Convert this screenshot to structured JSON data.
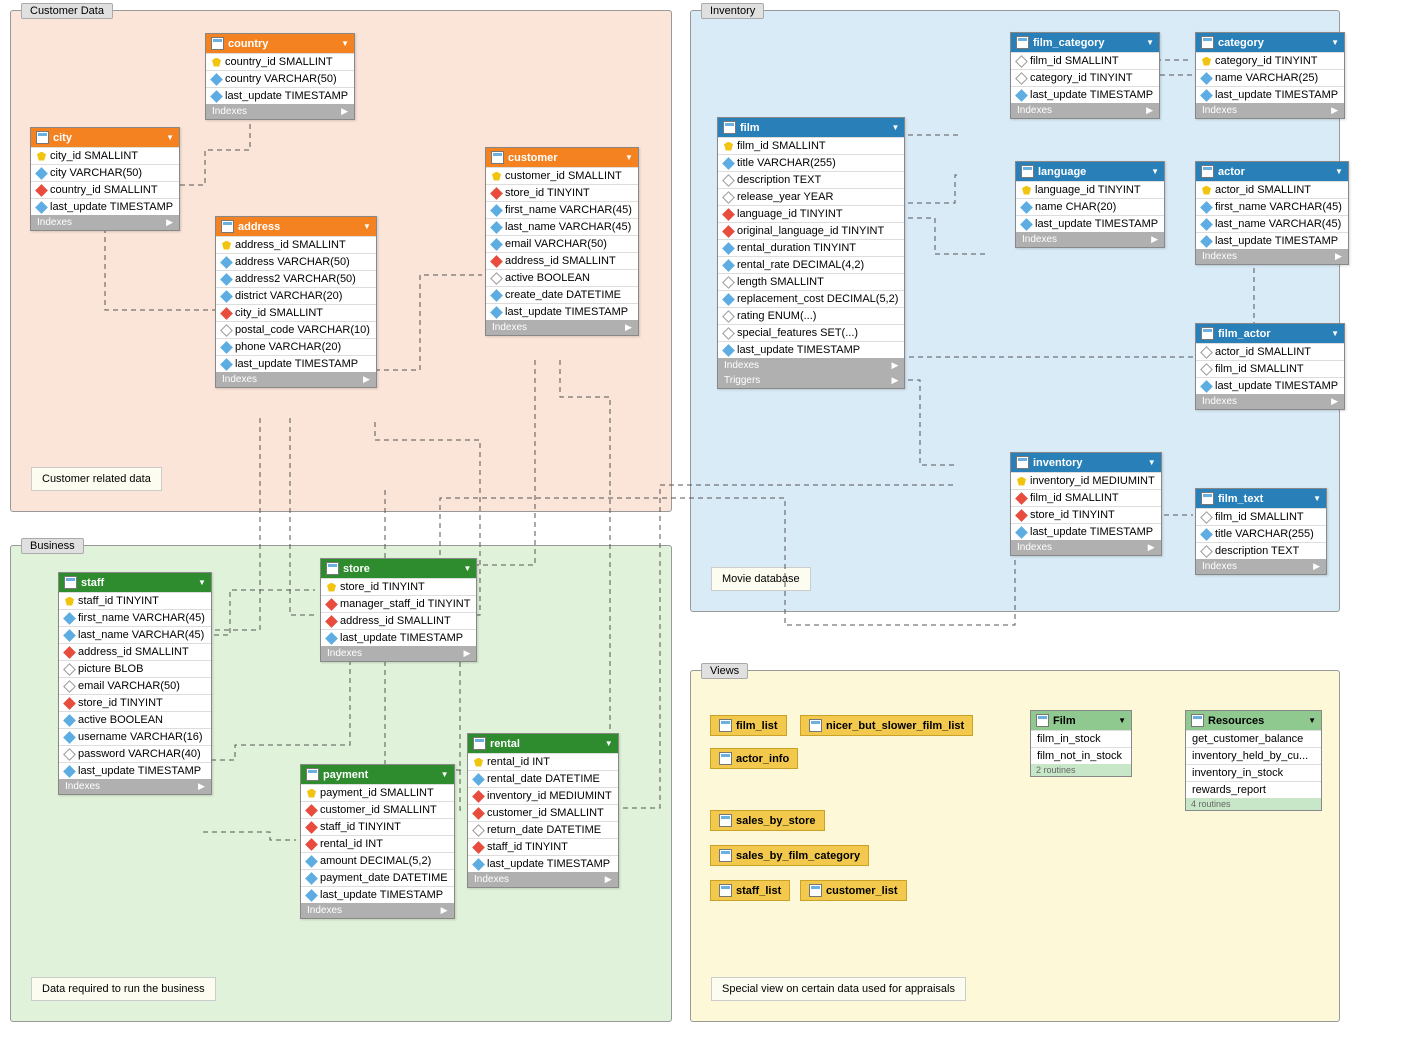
{
  "regions": {
    "customer": {
      "label": "Customer Data",
      "note": "Customer related data"
    },
    "business": {
      "label": "Business",
      "note": "Data required to run the business"
    },
    "inventory": {
      "label": "Inventory",
      "note": "Movie database"
    },
    "views": {
      "label": "Views",
      "note": "Special view on certain data used for appraisals"
    }
  },
  "tables": {
    "city": {
      "name": "city",
      "cols": [
        {
          "n": "city_id SMALLINT",
          "t": "key"
        },
        {
          "n": "city VARCHAR(50)",
          "t": "idx"
        },
        {
          "n": "country_id SMALLINT",
          "t": "fk"
        },
        {
          "n": "last_update TIMESTAMP",
          "t": "idx"
        }
      ]
    },
    "country": {
      "name": "country",
      "cols": [
        {
          "n": "country_id SMALLINT",
          "t": "key"
        },
        {
          "n": "country VARCHAR(50)",
          "t": "idx"
        },
        {
          "n": "last_update TIMESTAMP",
          "t": "idx"
        }
      ]
    },
    "address": {
      "name": "address",
      "cols": [
        {
          "n": "address_id SMALLINT",
          "t": "key"
        },
        {
          "n": "address VARCHAR(50)",
          "t": "idx"
        },
        {
          "n": "address2 VARCHAR(50)",
          "t": "idx"
        },
        {
          "n": "district VARCHAR(20)",
          "t": "idx"
        },
        {
          "n": "city_id SMALLINT",
          "t": "fk"
        },
        {
          "n": "postal_code VARCHAR(10)",
          "t": "col"
        },
        {
          "n": "phone VARCHAR(20)",
          "t": "idx"
        },
        {
          "n": "last_update TIMESTAMP",
          "t": "idx"
        }
      ]
    },
    "customer": {
      "name": "customer",
      "cols": [
        {
          "n": "customer_id SMALLINT",
          "t": "key"
        },
        {
          "n": "store_id TINYINT",
          "t": "fk"
        },
        {
          "n": "first_name VARCHAR(45)",
          "t": "idx"
        },
        {
          "n": "last_name VARCHAR(45)",
          "t": "idx"
        },
        {
          "n": "email VARCHAR(50)",
          "t": "idx"
        },
        {
          "n": "address_id SMALLINT",
          "t": "fk"
        },
        {
          "n": "active BOOLEAN",
          "t": "col"
        },
        {
          "n": "create_date DATETIME",
          "t": "idx"
        },
        {
          "n": "last_update TIMESTAMP",
          "t": "idx"
        }
      ]
    },
    "staff": {
      "name": "staff",
      "cols": [
        {
          "n": "staff_id TINYINT",
          "t": "key"
        },
        {
          "n": "first_name VARCHAR(45)",
          "t": "idx"
        },
        {
          "n": "last_name VARCHAR(45)",
          "t": "idx"
        },
        {
          "n": "address_id SMALLINT",
          "t": "fk"
        },
        {
          "n": "picture BLOB",
          "t": "col"
        },
        {
          "n": "email VARCHAR(50)",
          "t": "col"
        },
        {
          "n": "store_id TINYINT",
          "t": "fk"
        },
        {
          "n": "active BOOLEAN",
          "t": "idx"
        },
        {
          "n": "username VARCHAR(16)",
          "t": "idx"
        },
        {
          "n": "password VARCHAR(40)",
          "t": "col"
        },
        {
          "n": "last_update TIMESTAMP",
          "t": "idx"
        }
      ]
    },
    "store": {
      "name": "store",
      "cols": [
        {
          "n": "store_id TINYINT",
          "t": "key"
        },
        {
          "n": "manager_staff_id TINYINT",
          "t": "fk"
        },
        {
          "n": "address_id SMALLINT",
          "t": "fk"
        },
        {
          "n": "last_update TIMESTAMP",
          "t": "idx"
        }
      ]
    },
    "payment": {
      "name": "payment",
      "cols": [
        {
          "n": "payment_id SMALLINT",
          "t": "key"
        },
        {
          "n": "customer_id SMALLINT",
          "t": "fk"
        },
        {
          "n": "staff_id TINYINT",
          "t": "fk"
        },
        {
          "n": "rental_id INT",
          "t": "fk"
        },
        {
          "n": "amount DECIMAL(5,2)",
          "t": "idx"
        },
        {
          "n": "payment_date DATETIME",
          "t": "idx"
        },
        {
          "n": "last_update TIMESTAMP",
          "t": "idx"
        }
      ]
    },
    "rental": {
      "name": "rental",
      "cols": [
        {
          "n": "rental_id INT",
          "t": "key"
        },
        {
          "n": "rental_date DATETIME",
          "t": "idx"
        },
        {
          "n": "inventory_id MEDIUMINT",
          "t": "fk"
        },
        {
          "n": "customer_id SMALLINT",
          "t": "fk"
        },
        {
          "n": "return_date DATETIME",
          "t": "col"
        },
        {
          "n": "staff_id TINYINT",
          "t": "fk"
        },
        {
          "n": "last_update TIMESTAMP",
          "t": "idx"
        }
      ]
    },
    "film": {
      "name": "film",
      "cols": [
        {
          "n": "film_id SMALLINT",
          "t": "key"
        },
        {
          "n": "title VARCHAR(255)",
          "t": "idx"
        },
        {
          "n": "description TEXT",
          "t": "col"
        },
        {
          "n": "release_year YEAR",
          "t": "col"
        },
        {
          "n": "language_id TINYINT",
          "t": "fk"
        },
        {
          "n": "original_language_id TINYINT",
          "t": "fk"
        },
        {
          "n": "rental_duration TINYINT",
          "t": "idx"
        },
        {
          "n": "rental_rate DECIMAL(4,2)",
          "t": "idx"
        },
        {
          "n": "length SMALLINT",
          "t": "col"
        },
        {
          "n": "replacement_cost DECIMAL(5,2)",
          "t": "idx"
        },
        {
          "n": "rating ENUM(...)",
          "t": "col"
        },
        {
          "n": "special_features SET(...)",
          "t": "col"
        },
        {
          "n": "last_update TIMESTAMP",
          "t": "idx"
        }
      ]
    },
    "film_category": {
      "name": "film_category",
      "cols": [
        {
          "n": "film_id SMALLINT",
          "t": "col"
        },
        {
          "n": "category_id TINYINT",
          "t": "col"
        },
        {
          "n": "last_update TIMESTAMP",
          "t": "idx"
        }
      ]
    },
    "category": {
      "name": "category",
      "cols": [
        {
          "n": "category_id TINYINT",
          "t": "key"
        },
        {
          "n": "name VARCHAR(25)",
          "t": "idx"
        },
        {
          "n": "last_update TIMESTAMP",
          "t": "idx"
        }
      ]
    },
    "language": {
      "name": "language",
      "cols": [
        {
          "n": "language_id TINYINT",
          "t": "key"
        },
        {
          "n": "name CHAR(20)",
          "t": "idx"
        },
        {
          "n": "last_update TIMESTAMP",
          "t": "idx"
        }
      ]
    },
    "actor": {
      "name": "actor",
      "cols": [
        {
          "n": "actor_id SMALLINT",
          "t": "key"
        },
        {
          "n": "first_name VARCHAR(45)",
          "t": "idx"
        },
        {
          "n": "last_name VARCHAR(45)",
          "t": "idx"
        },
        {
          "n": "last_update TIMESTAMP",
          "t": "idx"
        }
      ]
    },
    "film_actor": {
      "name": "film_actor",
      "cols": [
        {
          "n": "actor_id SMALLINT",
          "t": "col"
        },
        {
          "n": "film_id SMALLINT",
          "t": "col"
        },
        {
          "n": "last_update TIMESTAMP",
          "t": "idx"
        }
      ]
    },
    "inventory": {
      "name": "inventory",
      "cols": [
        {
          "n": "inventory_id MEDIUMINT",
          "t": "key"
        },
        {
          "n": "film_id SMALLINT",
          "t": "fk"
        },
        {
          "n": "store_id TINYINT",
          "t": "fk"
        },
        {
          "n": "last_update TIMESTAMP",
          "t": "idx"
        }
      ]
    },
    "film_text": {
      "name": "film_text",
      "cols": [
        {
          "n": "film_id SMALLINT",
          "t": "col"
        },
        {
          "n": "title VARCHAR(255)",
          "t": "idx"
        },
        {
          "n": "description TEXT",
          "t": "col"
        }
      ]
    }
  },
  "indexes_label": "Indexes",
  "triggers_label": "Triggers",
  "views": {
    "film_list": "film_list",
    "nicer": "nicer_but_slower_film_list",
    "actor_info": "actor_info",
    "sales_store": "sales_by_store",
    "sales_cat": "sales_by_film_category",
    "staff_list": "staff_list",
    "customer_list": "customer_list"
  },
  "groups": {
    "film": {
      "name": "Film",
      "rows": [
        "film_in_stock",
        "film_not_in_stock"
      ],
      "foot": "2 routines"
    },
    "resources": {
      "name": "Resources",
      "rows": [
        "get_customer_balance",
        "inventory_held_by_cu...",
        "inventory_in_stock",
        "rewards_report"
      ],
      "foot": "4 routines"
    }
  }
}
